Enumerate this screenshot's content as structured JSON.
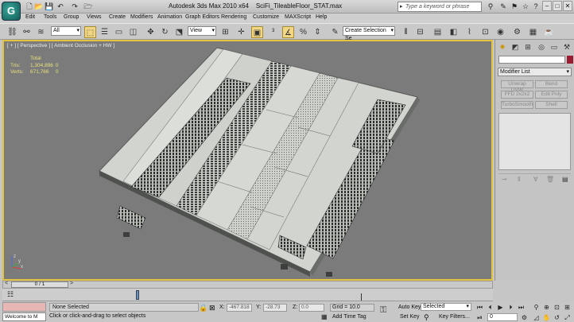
{
  "title_bar": {
    "app_icon_letter": "G",
    "title_left": "Autodesk 3ds Max  2010 x64",
    "title_right": "SciFi_TileableFloor_STAT.max",
    "search_placeholder": "Type a keyword or phrase"
  },
  "menu": [
    "Edit",
    "Tools",
    "Group",
    "Views",
    "Create",
    "Modifiers",
    "Animation",
    "Graph Editors",
    "Rendering",
    "Customize",
    "MAXScript",
    "Help"
  ],
  "toolbar": {
    "selection_filter": "All",
    "ref_coord": "View",
    "named_selection": "Create Selection Se"
  },
  "viewport": {
    "label": "[ + ] [ Perspective ] [ Ambient Occlusion + HW ]",
    "stats": {
      "header": "Total",
      "rows": [
        {
          "label": "Tris:",
          "total": "1,304,896",
          "sel": "0"
        },
        {
          "label": "Verts:",
          "total": "671,766",
          "sel": "0"
        }
      ]
    },
    "axis_labels": {
      "z": "z",
      "x": "x",
      "y": "y"
    }
  },
  "command_panel": {
    "modifier_list": "Modifier List",
    "buttons": [
      "Unwrap UVW",
      "Bend",
      "FFD 2x2x2",
      "Edit Poly",
      "TurboSmooth",
      "Shell"
    ],
    "color_swatch": "#9b1b33"
  },
  "time_slider": {
    "frame": "0 / 1",
    "prev": "<",
    "next": ">"
  },
  "status": {
    "selection": "None Selected",
    "prompt": "Click or click-and-drag to select objects",
    "listener_text": "Welcome to M",
    "x_label": "X:",
    "x_value": "-467.818",
    "y_label": "Y:",
    "y_value": "-28.73",
    "z_label": "Z:",
    "z_value": "0.0",
    "grid": "Grid = 10.0",
    "add_time_tag": "Add Time Tag",
    "auto_key": "Auto Key",
    "set_key": "Set Key",
    "selected_dd": "Selected",
    "key_filters": "Key Filters...",
    "frame_field": "0"
  }
}
